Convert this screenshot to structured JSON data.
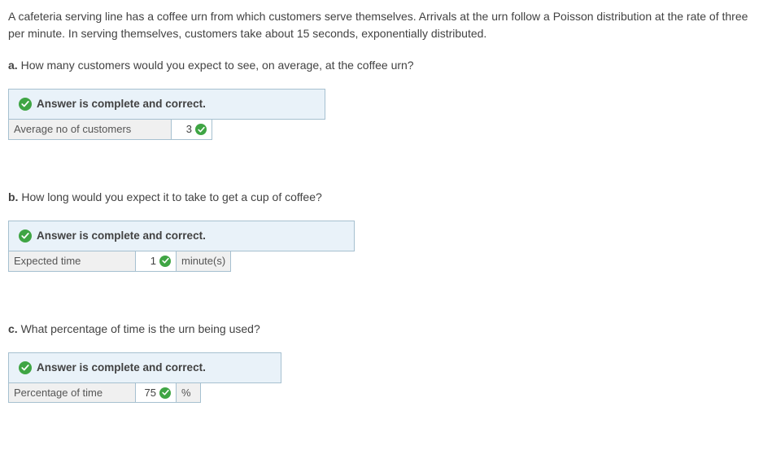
{
  "intro": "A cafeteria serving line has a coffee urn from which customers serve themselves. Arrivals at the urn follow a Poisson distribution at the rate of three per minute. In serving themselves, customers take about 15 seconds, exponentially distributed.",
  "status_text": "Answer is complete and correct.",
  "parts": {
    "a": {
      "marker": "a.",
      "prompt": "How many customers would you expect to see, on average, at the coffee urn?",
      "row_label": "Average no of customers",
      "value": "3"
    },
    "b": {
      "marker": "b.",
      "prompt": "How long would you expect it to take to get a cup of coffee?",
      "row_label": "Expected time",
      "value": "1",
      "unit": "minute(s)"
    },
    "c": {
      "marker": "c.",
      "prompt": "What percentage of time is the urn being used?",
      "row_label": "Percentage of time",
      "value": "75",
      "unit": "%"
    }
  }
}
